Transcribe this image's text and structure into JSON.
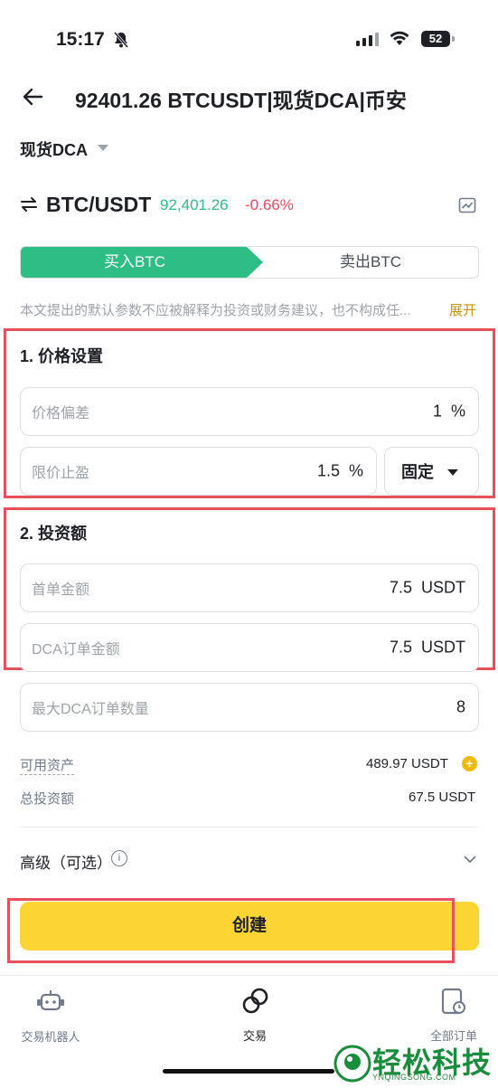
{
  "status_bar": {
    "time": "15:17",
    "battery": "52"
  },
  "header": {
    "title": "92401.26 BTCUSDT|现货DCA|币安"
  },
  "mode": {
    "label": "现货DCA"
  },
  "pair": {
    "symbol": "BTC/USDT",
    "price": "92,401.26",
    "change": "-0.66%"
  },
  "tabs": {
    "buy": "买入BTC",
    "sell": "卖出BTC"
  },
  "disclaimer": {
    "text": "本文提出的默认参数不应被解释为投资或财务建议，也不构成任...",
    "expand": "展开"
  },
  "price_settings": {
    "title": "1. 价格设置",
    "deviation": {
      "label": "价格偏差",
      "value": "1",
      "unit": "%"
    },
    "take_profit": {
      "label": "限价止盈",
      "value": "1.5",
      "unit": "%"
    },
    "mode_select": {
      "value": "固定"
    }
  },
  "investment": {
    "title": "2. 投资额",
    "first_order": {
      "label": "首单金额",
      "value": "7.5",
      "unit": "USDT"
    },
    "dca_order": {
      "label": "DCA订单金额",
      "value": "7.5",
      "unit": "USDT"
    },
    "max_orders": {
      "label": "最大DCA订单数量",
      "value": "8"
    }
  },
  "summary": {
    "available_label": "可用资产",
    "available_value": "489.97 USDT",
    "total_label": "总投资额",
    "total_value": "67.5 USDT"
  },
  "advanced": {
    "label": "高级（可选）"
  },
  "create_button": "创建",
  "bottom_nav": {
    "bots": "交易机器人",
    "trade": "交易",
    "orders": "全部订单"
  },
  "watermark": {
    "text": "轻松科技",
    "sub": "YNQINGSONG.COM"
  },
  "colors": {
    "green": "#2ebd85",
    "red": "#f6465d",
    "yellow": "#fcd535",
    "highlight": "#e8505b"
  }
}
